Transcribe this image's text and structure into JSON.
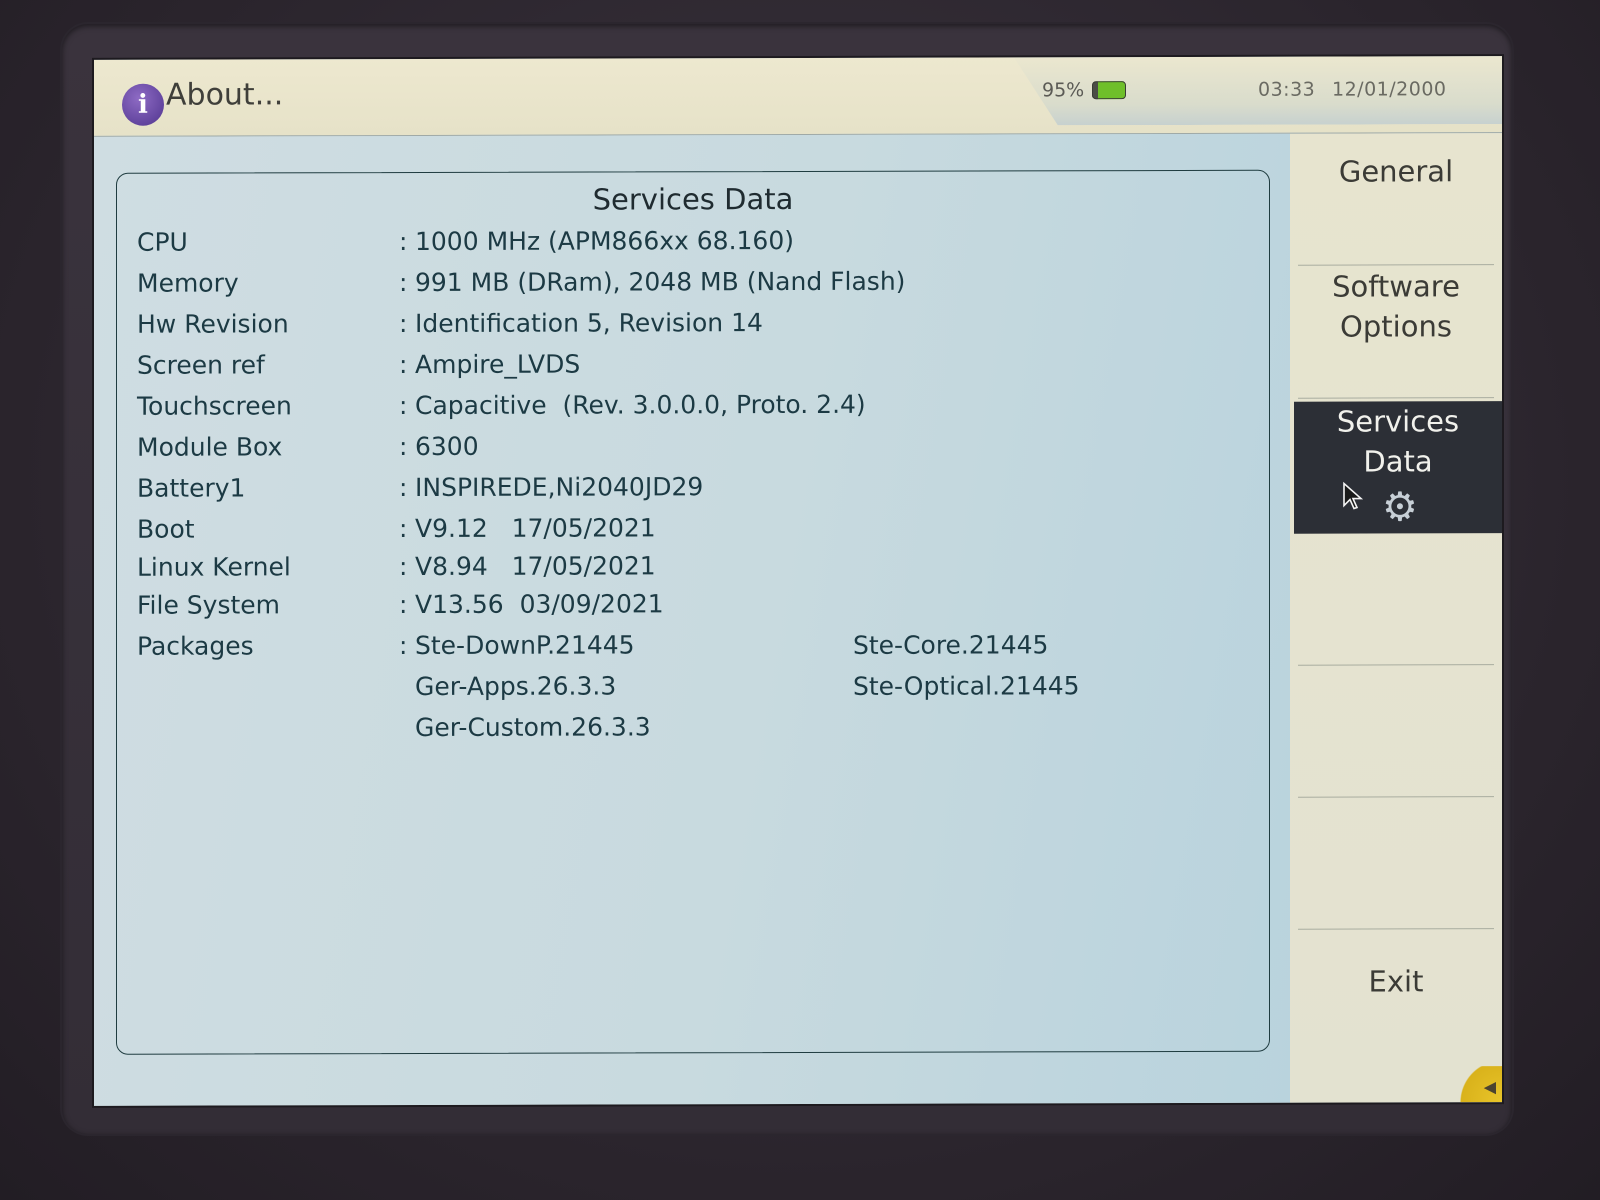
{
  "window": {
    "title": "About...",
    "icon": "info-icon"
  },
  "status_bar": {
    "battery_percent": "95%",
    "battery_level": 0.95,
    "battery_color": "#6fbf2a",
    "time": "03:33",
    "date": "12/01/2000"
  },
  "panel": {
    "title": "Services Data",
    "rows": [
      {
        "label": "CPU",
        "value": "1000 MHz (APM866xx 68.160)"
      },
      {
        "label": "Memory",
        "value": "991 MB (DRam), 2048 MB (Nand Flash)"
      },
      {
        "label": "Hw Revision",
        "value": "Identification 5, Revision 14"
      },
      {
        "label": "Screen ref",
        "value": "Ampire_LVDS"
      },
      {
        "label": "Touchscreen",
        "value": "Capacitive  (Rev. 3.0.0.0, Proto. 2.4)"
      },
      {
        "label": "Module Box",
        "value": "6300"
      },
      {
        "label": "Battery1",
        "value": "INSPIREDE,Ni2040JD29"
      },
      {
        "label": "Boot",
        "value": "V9.12   17/05/2021"
      },
      {
        "label": "Linux Kernel",
        "value": "V8.94   17/05/2021"
      },
      {
        "label": "File System",
        "value": "V13.56  03/09/2021"
      }
    ],
    "packages_label": "Packages",
    "packages": [
      "Ste-DownP.21445",
      "Ste-Core.21445",
      "Ger-Apps.26.3.3",
      "Ste-Optical.21445",
      "Ger-Custom.26.3.3"
    ],
    "separator": ":"
  },
  "menu": {
    "items": [
      {
        "label_line1": "General",
        "label_line2": ""
      },
      {
        "label_line1": "Software",
        "label_line2": "Options"
      },
      {
        "label_line1": "Services",
        "label_line2": "Data",
        "active": true,
        "icon": "gear-icon"
      },
      {
        "label_line1": "",
        "label_line2": ""
      },
      {
        "label_line1": "",
        "label_line2": ""
      },
      {
        "label_line1": "",
        "label_line2": ""
      },
      {
        "label_line1": "Exit",
        "label_line2": ""
      }
    ],
    "active_color": "#2c2f36"
  },
  "corner_button": {
    "icon": "triangle-left-icon",
    "glyph": "◀"
  }
}
